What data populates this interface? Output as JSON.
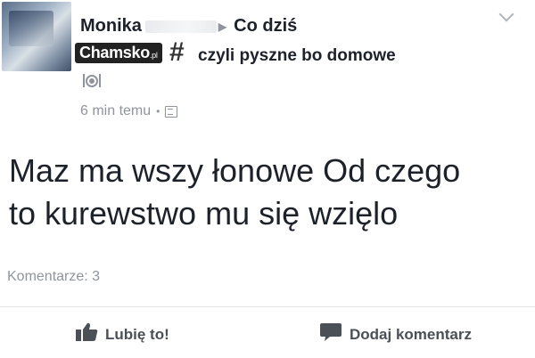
{
  "post": {
    "author_name": "Monika",
    "topic": "Co dziś",
    "activity": "czyli pyszne bo domowe",
    "watermark": "Chamsko",
    "watermark_suffix": ".pl",
    "timestamp": "6 min temu",
    "meta_separator": "•",
    "text_line1": "Maz ma wszy łonowe Od czego",
    "text_line2": "to kurewstwo mu się wzięlo",
    "comments_label": "Komentarze: 3"
  },
  "actions": {
    "like_label": "Lubię to!",
    "comment_label": "Dodaj komentarz"
  },
  "icons": {
    "activity": "dining-icon",
    "privacy": "friends-privacy-icon",
    "like": "thumbs-up-icon",
    "comment": "speech-bubble-icon",
    "menu": "chevron-down-icon"
  },
  "colors": {
    "text_primary": "#1d2129",
    "text_secondary": "#90949c",
    "action_text": "#4b4f56"
  }
}
